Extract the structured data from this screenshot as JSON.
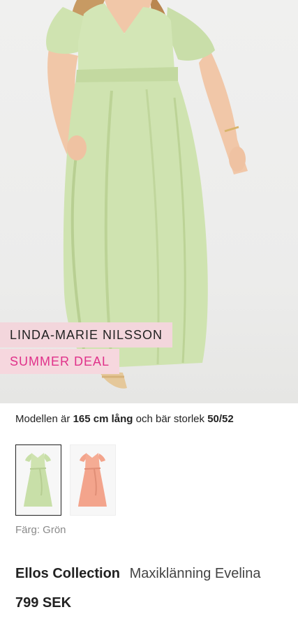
{
  "hero": {
    "image": "woman-in-green-maxi-dress",
    "designer_badge": "LINDA-MARIE NILSSON",
    "deal_badge": "SUMMER DEAL"
  },
  "model_info": {
    "prefix": "Modellen är",
    "height": "165 cm lång",
    "middle": "och bär storlek",
    "size": "50/52"
  },
  "swatches": [
    {
      "color_name": "Grön",
      "hex": "#c8dfa8",
      "selected": true
    },
    {
      "color_name": "Rosa",
      "hex": "#f3a48c",
      "selected": false
    }
  ],
  "color_label": "Färg: Grön",
  "product": {
    "brand": "Ellos Collection",
    "name": "Maxiklänning Evelina",
    "price": "799 SEK"
  },
  "colors": {
    "dress_green": "#cfe3b0",
    "badge_pink": "#f3d6dc",
    "deal_text": "#e0318a"
  }
}
